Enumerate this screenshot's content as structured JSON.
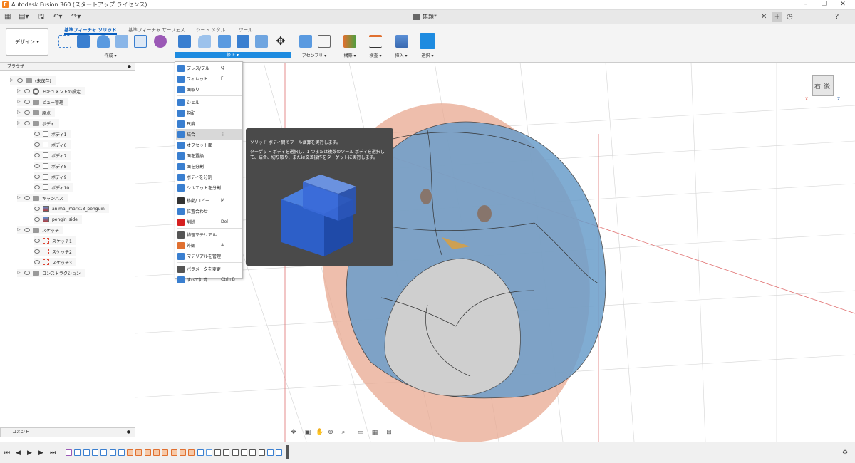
{
  "window": {
    "title": "Autodesk Fusion 360 (スタートアップ ライセンス)",
    "logo_letter": "F"
  },
  "document": {
    "name": "無題*"
  },
  "ribbon": {
    "workspace_button": "デザイン ▾",
    "tabs": [
      "基準フィーチャ ソリッド",
      "基準フィーチャ サーフェス",
      "シート メタル",
      "ツール"
    ],
    "groups": {
      "create": "作成 ▾",
      "modify": "修正 ▾",
      "assemble": "アセンブリ ▾",
      "construct": "構築 ▾",
      "inspect": "検査 ▾",
      "insert": "挿入 ▾",
      "select": "選択 ▾"
    }
  },
  "browser": {
    "title": "ブラウザ",
    "items": [
      {
        "label": "(未保存)",
        "level": 0,
        "icon": "root"
      },
      {
        "label": "ドキュメントの設定",
        "level": 1,
        "icon": "gear"
      },
      {
        "label": "ビュー管理",
        "level": 1,
        "icon": "folder"
      },
      {
        "label": "原点",
        "level": 1,
        "icon": "folder"
      },
      {
        "label": "ボディ",
        "level": 1,
        "icon": "folder"
      },
      {
        "label": "ボディ1",
        "level": 2,
        "icon": "body"
      },
      {
        "label": "ボディ6",
        "level": 2,
        "icon": "body"
      },
      {
        "label": "ボディ7",
        "level": 2,
        "icon": "body"
      },
      {
        "label": "ボディ8",
        "level": 2,
        "icon": "body"
      },
      {
        "label": "ボディ9",
        "level": 2,
        "icon": "body"
      },
      {
        "label": "ボディ10",
        "level": 2,
        "icon": "body"
      },
      {
        "label": "キャンバス",
        "level": 1,
        "icon": "folder"
      },
      {
        "label": "animal_mark13_penguin",
        "level": 2,
        "icon": "canvas"
      },
      {
        "label": "pengin_side",
        "level": 2,
        "icon": "canvas"
      },
      {
        "label": "スケッチ",
        "level": 1,
        "icon": "folder"
      },
      {
        "label": "スケッチ1",
        "level": 2,
        "icon": "sketch"
      },
      {
        "label": "スケッチ2",
        "level": 2,
        "icon": "sketch"
      },
      {
        "label": "スケッチ3",
        "level": 2,
        "icon": "sketch"
      },
      {
        "label": "コンストラクション",
        "level": 1,
        "icon": "folder"
      }
    ]
  },
  "comment": {
    "label": "コメント"
  },
  "modify_menu": [
    {
      "label": "プレス/プル",
      "shortcut": "Q",
      "color": "#3a7fd0"
    },
    {
      "label": "フィレット",
      "shortcut": "F",
      "color": "#3a7fd0"
    },
    {
      "label": "面取り",
      "shortcut": "",
      "color": "#3a7fd0"
    },
    {
      "sep": true
    },
    {
      "label": "シェル",
      "shortcut": "",
      "color": "#3a7fd0"
    },
    {
      "label": "勾配",
      "shortcut": "",
      "color": "#3a7fd0"
    },
    {
      "label": "尺度",
      "shortcut": "",
      "color": "#3a7fd0"
    },
    {
      "label": "結合",
      "shortcut": "⋮",
      "color": "#3a7fd0",
      "highlight": true
    },
    {
      "label": "オフセット面",
      "shortcut": "",
      "color": "#3a7fd0"
    },
    {
      "label": "面を置換",
      "shortcut": "",
      "color": "#3a7fd0"
    },
    {
      "label": "面を分割",
      "shortcut": "",
      "color": "#3a7fd0"
    },
    {
      "label": "ボディを分割",
      "shortcut": "",
      "color": "#3a7fd0"
    },
    {
      "label": "シルエットを分割",
      "shortcut": "",
      "color": "#3a7fd0"
    },
    {
      "sep": true
    },
    {
      "label": "移動/コピー",
      "shortcut": "M",
      "color": "#333333"
    },
    {
      "label": "位置合わせ",
      "shortcut": "",
      "color": "#3a7fd0"
    },
    {
      "label": "削除",
      "shortcut": "Del",
      "color": "#d62020"
    },
    {
      "sep": true
    },
    {
      "label": "物理マテリアル",
      "shortcut": "",
      "color": "#555555"
    },
    {
      "label": "外観",
      "shortcut": "A",
      "color": "#e07030"
    },
    {
      "label": "マテリアルを管理",
      "shortcut": "",
      "color": "#3a7fd0"
    },
    {
      "sep": true
    },
    {
      "label": "パラメータを変更",
      "shortcut": "",
      "color": "#555555"
    },
    {
      "label": "すべて計算",
      "shortcut": "Ctrl+B",
      "color": "#3a7fd0"
    }
  ],
  "tooltip": {
    "title": "ソリッド ボディ間でブール演算を実行します。",
    "body": "ターゲット ボディを選択し、1 つまたは複数のツール ボディを選択して、結合、切り取り、または交差操作をターゲットに実行します。"
  },
  "viewcube": {
    "top_label": "右",
    "front_label": "後",
    "axis_x": "X",
    "axis_z": "Z"
  },
  "colors": {
    "accent": "#1e8be0",
    "body_blue": "#6b9ecb",
    "canvas_salmon": "#e8a890"
  }
}
